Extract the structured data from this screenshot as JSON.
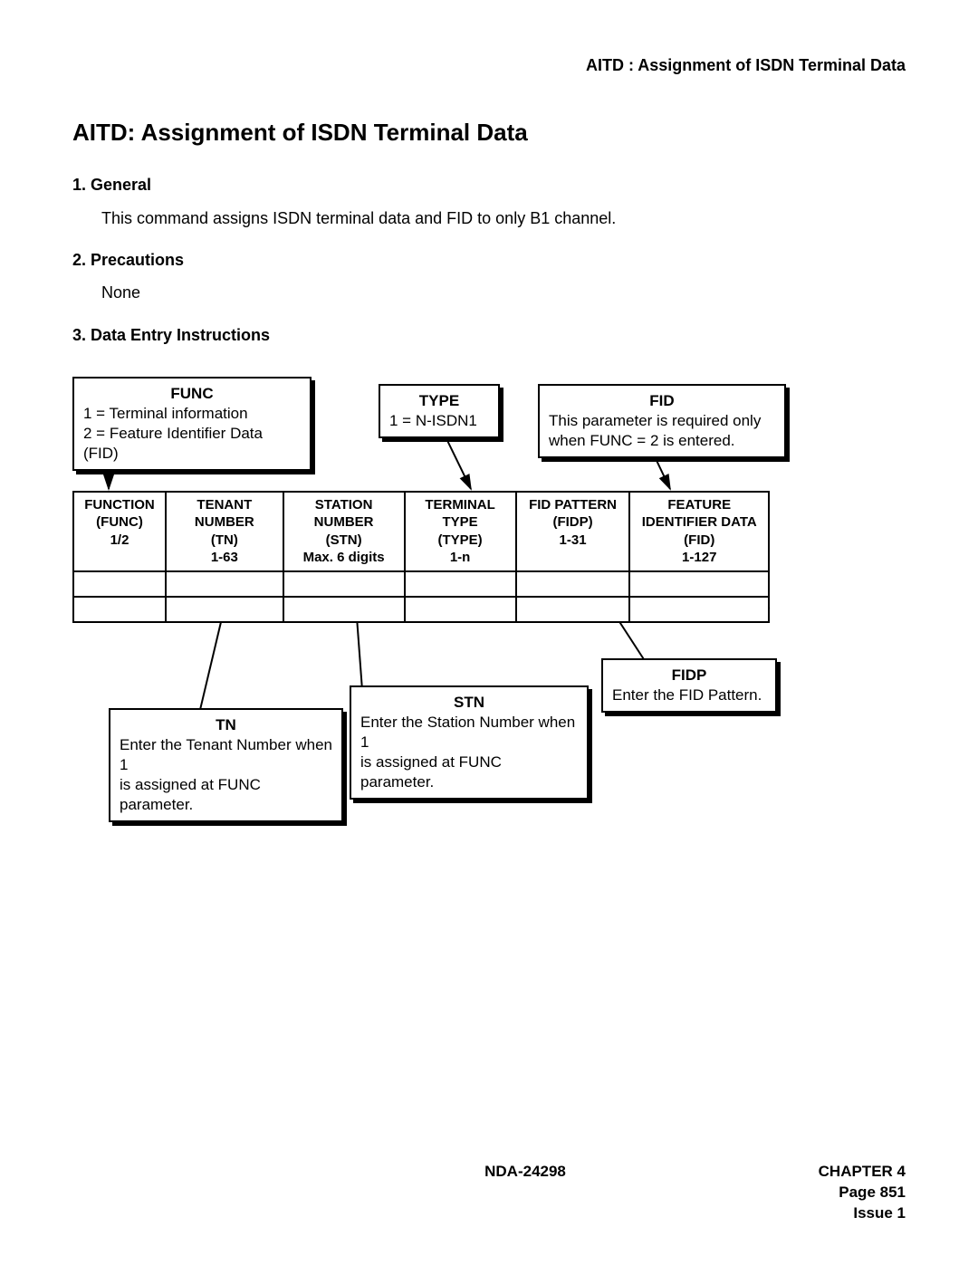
{
  "header_right": "AITD : Assignment of ISDN Terminal Data",
  "title": "AITD: Assignment of ISDN Terminal Data",
  "sections": {
    "s1_head": "1.  General",
    "s1_body": "This command assigns ISDN terminal data and FID to only B1 channel.",
    "s2_head": "2.  Precautions",
    "s2_body": "None",
    "s3_head": "3.  Data Entry Instructions"
  },
  "callouts": {
    "func": {
      "title": "FUNC",
      "l1": "1 = Terminal information",
      "l2": "2 = Feature Identifier Data (FID)"
    },
    "type": {
      "title": "TYPE",
      "l1": "1 = N-ISDN1"
    },
    "fid": {
      "title": "FID",
      "l1": "This parameter is required only",
      "l2": "when FUNC = 2  is entered."
    },
    "tn": {
      "title": "TN",
      "l1": "Enter the Tenant Number when 1",
      "l2": "is assigned at FUNC parameter."
    },
    "stn": {
      "title": "STN",
      "l1": "Enter the Station Number when 1",
      "l2": "is assigned at FUNC parameter."
    },
    "fidp": {
      "title": "FIDP",
      "l1": "Enter the FID Pattern."
    }
  },
  "table": {
    "headers": [
      {
        "l1": "FUNCTION",
        "l2": "(FUNC)",
        "l3": "1/2",
        "l4": ""
      },
      {
        "l1": "TENANT",
        "l2": "NUMBER",
        "l3": "(TN)",
        "l4": "1-63"
      },
      {
        "l1": "STATION",
        "l2": "NUMBER",
        "l3": "(STN)",
        "l4": "Max. 6 digits"
      },
      {
        "l1": "TERMINAL",
        "l2": "TYPE",
        "l3": "(TYPE)",
        "l4": "1-n"
      },
      {
        "l1": "FID PATTERN",
        "l2": "(FIDP)",
        "l3": "1-31",
        "l4": ""
      },
      {
        "l1": "FEATURE",
        "l2": "IDENTIFIER DATA",
        "l3": "(FID)",
        "l4": "1-127"
      }
    ]
  },
  "footer": {
    "center": "NDA-24298",
    "right_l1": "CHAPTER 4",
    "right_l2": "Page 851",
    "right_l3": "Issue 1"
  }
}
